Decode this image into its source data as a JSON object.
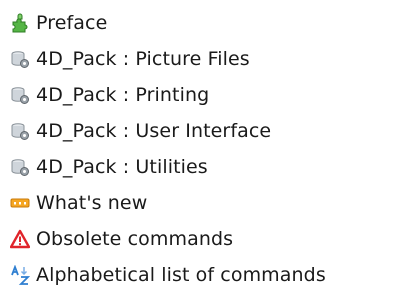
{
  "items": [
    {
      "label": "Preface",
      "icon": "puzzle-icon"
    },
    {
      "label": "4D_Pack : Picture Files",
      "icon": "plugin-database-gear-icon"
    },
    {
      "label": "4D_Pack : Printing",
      "icon": "plugin-database-gear-icon"
    },
    {
      "label": "4D_Pack : User Interface",
      "icon": "plugin-database-gear-icon"
    },
    {
      "label": "4D_Pack : Utilities",
      "icon": "plugin-database-gear-icon"
    },
    {
      "label": "What's new",
      "icon": "new-badge-icon"
    },
    {
      "label": "Obsolete commands",
      "icon": "warning-triangle-icon"
    },
    {
      "label": "Alphabetical list of commands",
      "icon": "alphabetical-sort-icon"
    }
  ],
  "colors": {
    "text": "#1a1a1a",
    "puzzle_green": "#4caf3a",
    "new_orange": "#f39b16",
    "warning_red": "#e0242b",
    "alpha_blue": "#2f7fd1"
  }
}
